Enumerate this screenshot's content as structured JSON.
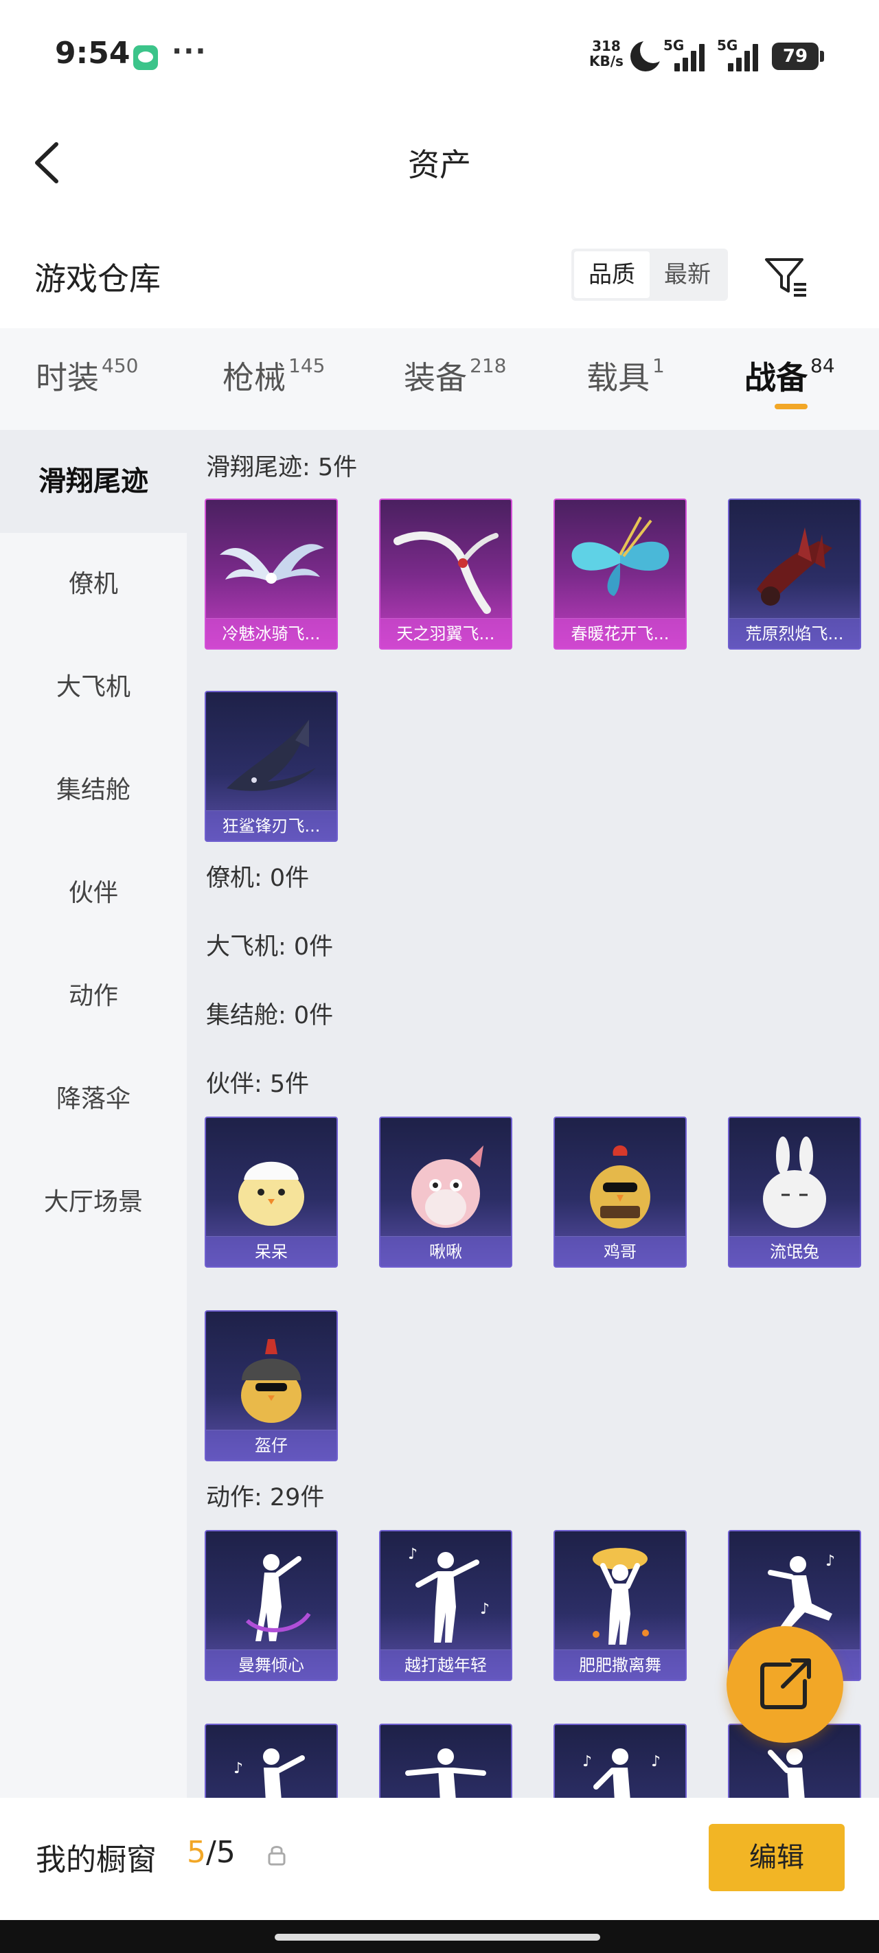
{
  "status_bar": {
    "time": "9:54",
    "dots": "···",
    "net_speed_value": "318",
    "net_speed_unit": "KB/s",
    "sim1": "5G",
    "sim2": "5G",
    "battery": "79"
  },
  "nav": {
    "title": "资产",
    "back_icon": "back-arrow-icon"
  },
  "section": {
    "title": "游戏仓库",
    "sort_options": [
      "品质",
      "最新"
    ],
    "sort_selected": "品质",
    "filter_icon": "filter-icon"
  },
  "tabs": [
    {
      "label": "时装",
      "count": "450"
    },
    {
      "label": "枪械",
      "count": "145"
    },
    {
      "label": "装备",
      "count": "218"
    },
    {
      "label": "载具",
      "count": "1"
    },
    {
      "label": "战备",
      "count": "84"
    }
  ],
  "active_tab": "战备",
  "sidebar": [
    "滑翔尾迹",
    "僚机",
    "大飞机",
    "集结舱",
    "伙伴",
    "动作",
    "降落伞",
    "大厅场景"
  ],
  "sidebar_active": "滑翔尾迹",
  "categories": [
    {
      "label": "滑翔尾迹: 5件",
      "items": [
        "冷魅冰骑飞...",
        "天之羽翼飞...",
        "春暖花开飞...",
        "荒原烈焰飞...",
        "狂鲨锋刃飞..."
      ]
    },
    {
      "label": "僚机: 0件",
      "items": []
    },
    {
      "label": "大飞机: 0件",
      "items": []
    },
    {
      "label": "集结舱: 0件",
      "items": []
    },
    {
      "label": "伙伴: 5件",
      "items": [
        "呆呆",
        "啾啾",
        "鸡哥",
        "流氓兔",
        "盔仔"
      ]
    },
    {
      "label": "动作: 29件",
      "items": [
        "曼舞倾心",
        "越打越年轻",
        "肥肥撒离舞",
        ""
      ]
    }
  ],
  "share_icon": "share-external-icon",
  "bottom_bar": {
    "label": "我的橱窗",
    "count_current": "5",
    "count_total": "/5",
    "lock_icon": "lock-icon",
    "edit_label": "编辑"
  },
  "colors": {
    "accent": "#f2a727",
    "edit_button": "#f2b525",
    "rare_card": "#c03ec0",
    "epic_card": "#5a4fa8"
  }
}
